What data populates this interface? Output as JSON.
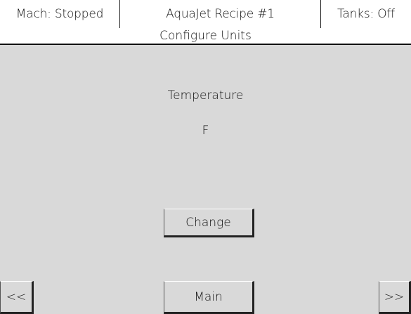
{
  "status": {
    "machine": "Mach: Stopped",
    "recipe": "AquaJet Recipe #1",
    "tanks": "Tanks: Off"
  },
  "screen": {
    "title": "Configure Units"
  },
  "setting": {
    "label": "Temperature",
    "value": "F"
  },
  "buttons": {
    "change": "Change",
    "main": "Main",
    "prev": "<<",
    "next": ">>"
  },
  "colors": {
    "background": "#d9d9d9",
    "header": "#ffffff",
    "text": "#111111"
  }
}
